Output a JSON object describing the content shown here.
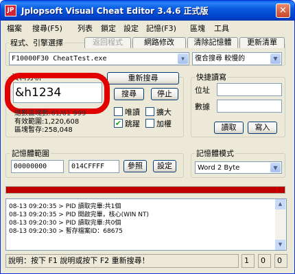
{
  "window": {
    "title": "Jplopsoft Visual Cheat Editor 3.4.6 正式版",
    "app_icon_text": "JP"
  },
  "menu": [
    "檔案",
    "搜尋(F5)",
    "列表",
    "鎖定",
    "設定",
    "記憶(F3)",
    "區塊",
    "工具"
  ],
  "program_group": {
    "title": "程式、引擎選擇",
    "tabs": [
      "返回程式",
      "網路修改",
      "清除記憶體",
      "更新清單"
    ],
    "process_value": "F10000F30 CheatTest.exe",
    "search_mode": "復合搜尋 較慢的"
  },
  "search": {
    "group_title": "資料分析",
    "input_value": "&h1234",
    "research_label": "重新搜尋",
    "search_label": "搜尋",
    "stop_label": "停止",
    "counter_text": "總數區塊數:61/61 999",
    "valid_range": "有效範圍:1,220,608",
    "block_temp": "區塊暫存:258,048",
    "options": [
      {
        "label": "唯讀",
        "checked": false
      },
      {
        "label": "擴大",
        "checked": false
      },
      {
        "label": "跳躍",
        "checked": true
      },
      {
        "label": "加權",
        "checked": false
      }
    ]
  },
  "quick_rw": {
    "title": "快捷讀寫",
    "address_label": "位址",
    "value_label": "數據",
    "read_label": "讀取",
    "write_label": "寫入"
  },
  "memory_range": {
    "title": "記憶體範圍",
    "start": "00000000",
    "end": "014CFFFF",
    "browse_label": "參照",
    "settings_label": "設定"
  },
  "memory_mode": {
    "title": "記憶體模式",
    "selected": "Word 2 Byte"
  },
  "progress": {
    "value": 1.0
  },
  "log": [
    "08-13 09:20:35 > PID 讀取完畢:共1個",
    "08-13 09:20:35 > PID 開啟完畢，核心(WIN NT)",
    "08-13 09:20:30 > PID 讀取完畢:共0個",
    "08-13 09:20:30 > 暫存檔案ID：68675"
  ],
  "status": {
    "text": "說明：按下 F1 說明或按下 F2 重新搜尋！",
    "cell1": "1",
    "cell2": "0",
    "cell3": "0"
  },
  "colors": {
    "highlight_ring": "#e00000",
    "progress": "#c00000",
    "title_bar": "#0a5bdf"
  }
}
